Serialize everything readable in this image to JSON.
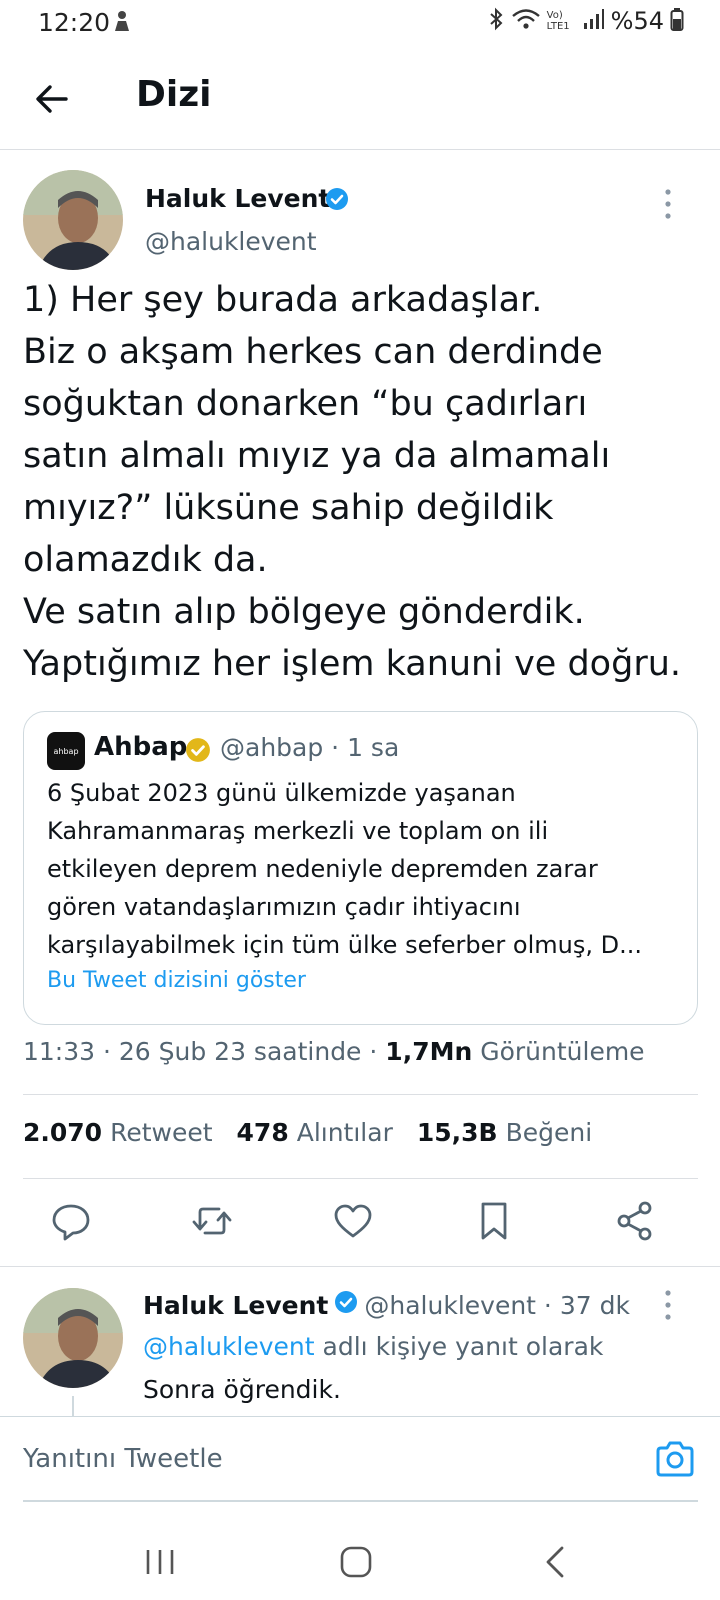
{
  "status_bar": {
    "time": "12:20",
    "network": "Vo) LTE1",
    "battery": "%54",
    "icons": [
      "bluetooth-icon",
      "wifi-icon",
      "signal-icon",
      "battery-icon"
    ]
  },
  "header": {
    "title": "Dizi",
    "back_icon": "arrow-left-icon"
  },
  "main_tweet": {
    "author_name": "Haluk Levent",
    "verified": true,
    "handle": "@haluklevent",
    "text_lines": [
      "1) Her şey burada arkadaşlar.",
      "Biz o akşam herkes can derdinde",
      "soğuktan donarken “bu çadırları",
      "satın almalı mıyız ya da almamalı",
      "mıyız?” lüksüne sahip değildik",
      "olamazdık da.",
      "Ve satın alıp bölgeye gönderdik.",
      "Yaptığımız her işlem kanuni ve doğru."
    ],
    "quote": {
      "logo_text": "ahbap",
      "name": "Ahbap",
      "verified_color": "#e2b719",
      "handle_time": "@ahbap · 1 sa",
      "text_lines": [
        "6 Şubat 2023 günü ülkemizde yaşanan",
        "Kahramanmaraş merkezli ve toplam on ili",
        "etkileyen deprem nedeniyle depremden zarar",
        "gören vatandaşlarımızın çadır ihtiyacını",
        "karşılayabilmek için tüm ülke seferber olmuş, D..."
      ],
      "show_thread_label": "Bu Tweet dizisini göster"
    },
    "meta": {
      "time_date": "11:33 · 26 Şub 23 saatinde ·",
      "views_count": "1,7Mn",
      "views_label": "Görüntüleme"
    },
    "stats": {
      "retweets_count": "2.070",
      "retweets_label": "Retweet",
      "quotes_count": "478",
      "quotes_label": "Alıntılar",
      "likes_count": "15,3B",
      "likes_label": "Beğeni"
    }
  },
  "reply_tweet": {
    "author_name": "Haluk Levent",
    "verified": true,
    "handle_time": "@haluklevent · 37 dk",
    "reply_to_link": "@haluklevent",
    "reply_to_suffix": "adlı kişiye yanıt olarak",
    "text": "Sonra öğrendik."
  },
  "composer": {
    "placeholder": "Yanıtını Tweetle"
  },
  "colors": {
    "accent": "#1d9bf0",
    "text_primary": "#0f1419",
    "text_secondary": "#536471",
    "divider": "#dcdfe3"
  }
}
